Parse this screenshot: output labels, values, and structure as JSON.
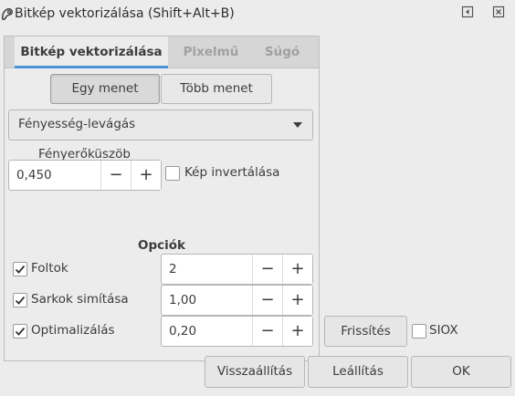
{
  "window": {
    "title": "Bitkép vektorizálása (Shift+Alt+B)"
  },
  "tabs": [
    {
      "label": "Bitkép vektorizálása",
      "active": true
    },
    {
      "label": "Pixelmű",
      "active": false
    },
    {
      "label": "Súgó",
      "active": false
    }
  ],
  "mode": {
    "single_label": "Egy menet",
    "multi_label": "Több menet",
    "selected": "Egy menet"
  },
  "method": {
    "selected": "Fényesség-levágás"
  },
  "threshold": {
    "label": "Fényerőküszöb",
    "value": "0,450",
    "invert_label": "Kép invertálása",
    "invert_checked": false
  },
  "options": {
    "title": "Opciók",
    "items": [
      {
        "label": "Foltok",
        "checked": true,
        "value": "2"
      },
      {
        "label": "Sarkok simítása",
        "checked": true,
        "value": "1,00"
      },
      {
        "label": "Optimalizálás",
        "checked": true,
        "value": "0,20"
      }
    ]
  },
  "preview": {
    "refresh_label": "Frissítés",
    "siox_label": "SIOX",
    "siox_checked": false
  },
  "actions": {
    "reset_label": "Visszaállítás",
    "stop_label": "Leállítás",
    "ok_label": "OK"
  },
  "spin_glyphs": {
    "minus": "−",
    "plus": "+"
  },
  "colors": {
    "accent": "#4a90d9",
    "window_bg": "#ececec",
    "tabbar_bg": "#d6d6d6"
  }
}
